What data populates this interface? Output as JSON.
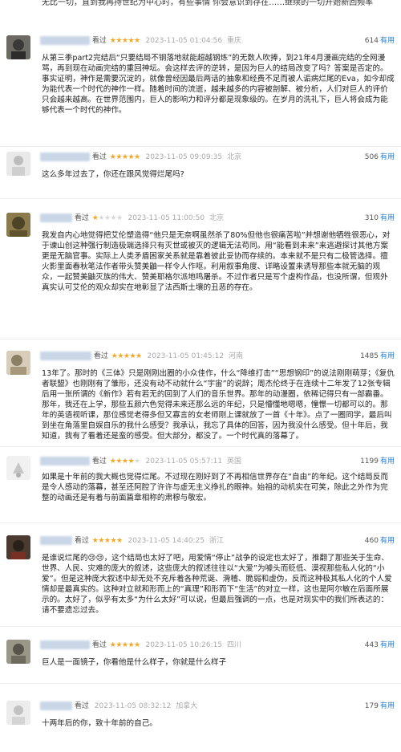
{
  "top_fragment": "无比一切，直到我再持世纪为中心时，有些事情 你会意识到存在……继续的一切开始新回频率",
  "comments": [
    {
      "seen": "看过",
      "stars_filled": 5,
      "date": "2023-11-05 01:04:56",
      "location": "重庆",
      "votes": "614",
      "useful": "有用",
      "text": "从第三季part2完结后“只要结局不钢落地就能超越钢炼”的无数人吹捧，到21年4月漫画完结的全网漫骂，再到现在动画完结的重回神坛。会这样去评的逆转，是因为巨人的结局改变了吗？答案是否定的。事实证明，神作是需要沉淀的，就像曾经因最后两话的抽象和经费不足而被人诟病烂尾的Eva，如今却成为能代表一个时代的神作一样。随着时间的流逝，越来越多的内容被剖解、被分析，人们对巨人的评价只会越来越高。在世界范围内，巨人的影响力和评分都是现象级的。在岁月的洗礼下，巨人将会成为能够代表一个时代的神作。"
    },
    {
      "seen": "看过",
      "stars_filled": 5,
      "date": "2023-11-05 09:09:35",
      "location": "北京",
      "votes": "506",
      "useful": "有用",
      "text": "这么多年过去了，你还在跟风觉得烂尾吗?"
    },
    {
      "seen": "看过",
      "stars_filled": 1,
      "date": "2023-11-05 11:00:50",
      "location": "北京",
      "votes": "310",
      "useful": "有用",
      "text": "我发自内心地觉得把艾伦塑造得“他只是无奈啊虽然杀了80%但他也很痛苦啦”并想谢他牺牲很恶心，对于谏山创这种强行制造极端选择只有灭世或被灭的逻辑无法苟同。用“能看到未来”来逃避探讨其他方案更是无脑官事。实际上人类矛盾困家关系就是靠着彼此妥协而存续的。本来就不是只有二极管选择。擅火影里面春秋笔法作者带头赞美鼬一样令人作呕。利用叙事角度、详略设置来诱导那些本就无脑的观众，一起赞美鼬灭族的伟大、赞美耶格尔派地鸣屠杀。不过作者只是写个虚构作品，也没所谓，但观外真实认可艾伦的观众却实在地彰显了法西斯土壤的丑恶的存在。"
    },
    {
      "seen": "看过",
      "stars_filled": 5,
      "date": "2023-11-05 01:45:12",
      "location": "河南",
      "votes": "1485",
      "useful": "有用",
      "text": "13年了。那时的《三体》只是刚刚出圈的小众佳作，什么“降维打击”“思想钢印”的说法刚刚萌芽；《复仇者联盟》也刚刚有了雏形，还没有动不动就什么“宇宙”的说辞；周杰伦终于在连续十二年发了12张专辑后用一张所谓的《新作》若有若无的回到了人们的音乐世界。那年的动漫圈，依稀记得只有一部霸番。那年，我还在上学，那些五颜六色觉得未来还那么远的年纪，只是懵懂地嗯嗯，憧憬一切都可以的。那年的英语视听课，那位感觉老得多但又寡言的女老师刚上课就放了一首《十年》。点了一圈同学，最后叫到坐在角落里自娱自乐的我什么感受？我承认，我忘了具体的回答，因为我没什么感受。但十年后，我知道，我有了看着还是蛮的感受。但大部分，都没了。一个时代真的落幕了。"
    },
    {
      "seen": "看过",
      "stars_filled": 4,
      "date": "2023-11-05 05:57:11",
      "location": "英国",
      "votes": "1199",
      "useful": "有用",
      "text": "如果是十年前的我大概也觉得烂尾。不过现在刚好到了不再相信世界存在“自由”的年纪。这个结局反而是令人感动的落幕，甚至还阿腔了许许与虚无主义挣扎的眼神。始祖的动机实在可笑，除此之外作为完整的动画还是有着与前面篇章相称的肃穆与敬宏。"
    },
    {
      "seen": "看过",
      "stars_filled": 5,
      "date": "2023-11-05 14:40:25",
      "location": "浙江",
      "votes": "460",
      "useful": "有用",
      "text": "是谁说烂尾的😢😢，这个结局也太好了吧，用爱情“停止”战争的设定也太好了，推翻了那些关于生命、世界、人民、灾难的庞大的叙述，这些庞大的叙述往往以“大爱”为噱头而贬低、漠视那些私人化的“小爱”。但是这种庞大叙述中却无处不充斥着各种荒诞、滑稽、脆弱和虚伪，反而这种极其私人化的个人爱情却是最真实的。这种对立就和形而上的“真理”和形而下“生活”的对立一样，这也是阿尔敏在后面所展示的。太好了，似乎有太多“为什么太好”可以说，但最后强调的一点，也是对现实中的我们所表达的：请不要遗忘过去。"
    },
    {
      "seen": "看过",
      "stars_filled": 5,
      "date": "2023-11-05 10:26:15",
      "location": "四川",
      "votes": "443",
      "useful": "有用",
      "text": "巨人是一面镜子，你看他是什么样子，你就是什么样子"
    },
    {
      "seen": "看过",
      "stars_filled": 0,
      "date": "2023-11-05 08:32:12",
      "location": "加拿大",
      "votes": "179",
      "useful": "有用",
      "text": "十两年后的你，致十年前的自己。"
    }
  ]
}
